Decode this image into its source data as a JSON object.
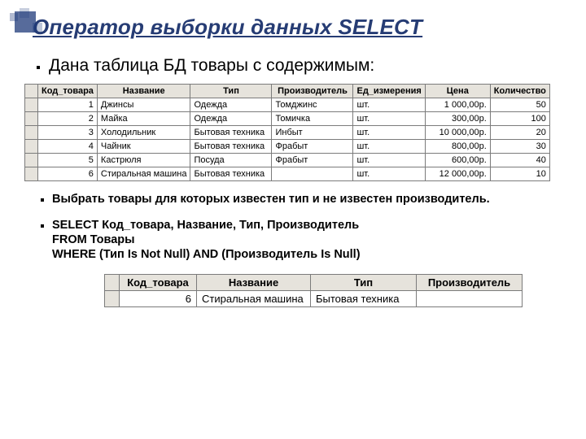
{
  "title": "Оператор выборки данных SELECT",
  "intro": "Дана таблица БД товары с содержимым:",
  "table1": {
    "headers": [
      "",
      "Код_товара",
      "Название",
      "Тип",
      "Производитель",
      "Ед_измерения",
      "Цена",
      "Количество"
    ],
    "rows": [
      [
        "1",
        "Джинсы",
        "Одежда",
        "Томджинс",
        "шт.",
        "1 000,00р.",
        "50"
      ],
      [
        "2",
        "Майка",
        "Одежда",
        "Томичка",
        "шт.",
        "300,00р.",
        "100"
      ],
      [
        "3",
        "Холодильник",
        "Бытовая техника",
        "Инбыт",
        "шт.",
        "10 000,00р.",
        "20"
      ],
      [
        "4",
        "Чайник",
        "Бытовая техника",
        "Фрабыт",
        "шт.",
        "800,00р.",
        "30"
      ],
      [
        "5",
        "Кастрюля",
        "Посуда",
        "Фрабыт",
        "шт.",
        "600,00р.",
        "40"
      ],
      [
        "6",
        "Стиральная машина",
        "Бытовая техника",
        "",
        "шт.",
        "12 000,00р.",
        "10"
      ]
    ]
  },
  "task": "Выбрать товары для которых известен тип и не известен производитель.",
  "sql": {
    "line1": "SELECT Код_товара, Название, Тип, Производитель",
    "line2": "FROM Товары",
    "line3": "WHERE (Тип Is Not Null) AND (Производитель Is Null)"
  },
  "table2": {
    "headers": [
      "",
      "Код_товара",
      "Название",
      "Тип",
      "Производитель"
    ],
    "rows": [
      [
        "6",
        "Стиральная машина",
        "Бытовая техника",
        ""
      ]
    ]
  }
}
